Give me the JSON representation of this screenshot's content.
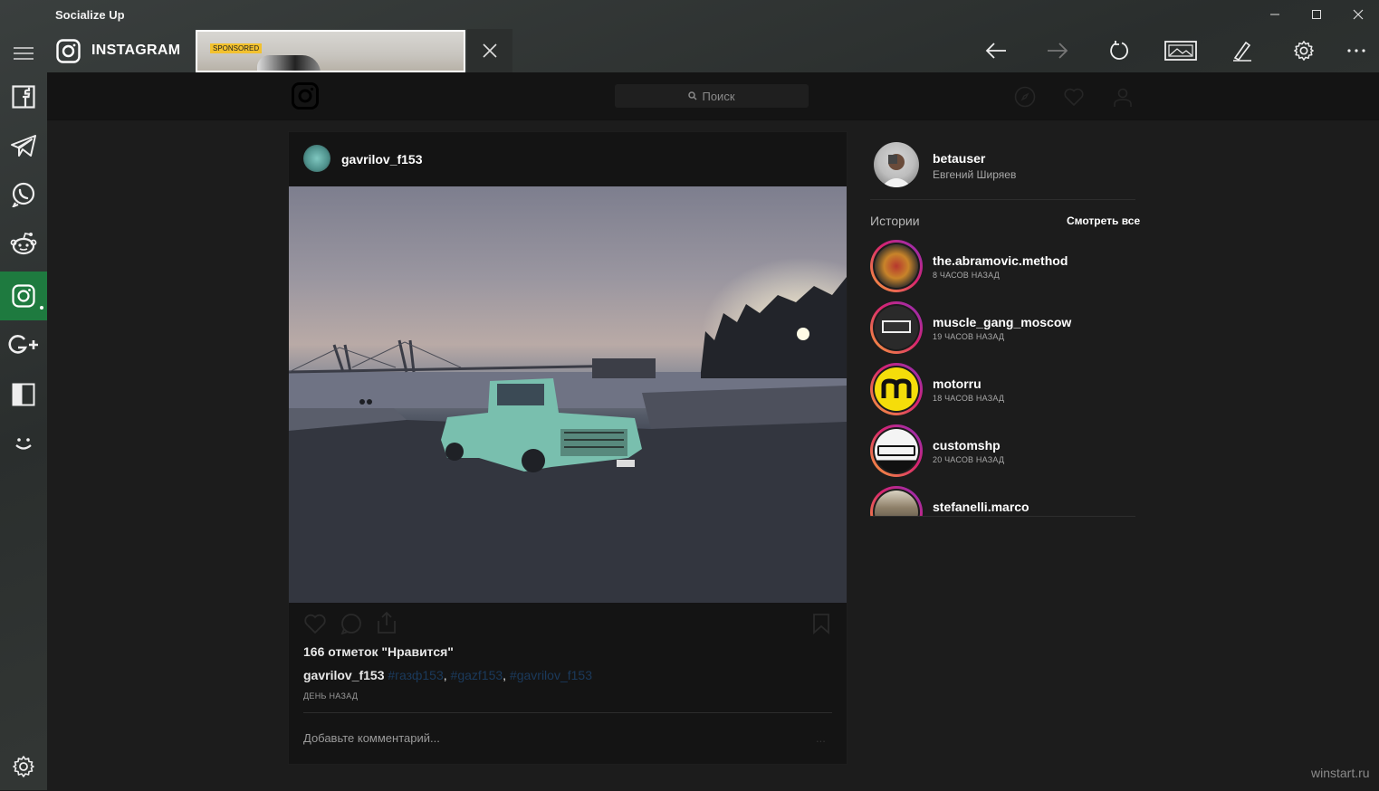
{
  "app": {
    "title": "Socialize Up"
  },
  "window": {
    "minimize": "minimize-icon",
    "maximize": "maximize-icon",
    "close": "close-icon"
  },
  "tab": {
    "name": "INSTAGRAM"
  },
  "ad": {
    "badge": "SPONSORED"
  },
  "header": {
    "search_placeholder": "Поиск"
  },
  "post": {
    "username": "gavrilov_f153",
    "likes": "166 отметок \"Нравится\"",
    "caption_user": "gavrilov_f153",
    "tags": [
      "#газф153",
      "#gazf153",
      "#gavrilov_f153"
    ],
    "time": "ДЕНЬ НАЗАД",
    "comment_placeholder": "Добавьте комментарий...",
    "more": "..."
  },
  "sidebar": {
    "user": {
      "username": "betauser",
      "full_name": "Евгений Ширяев"
    },
    "stories_title": "Истории",
    "see_all": "Смотреть все",
    "stories": [
      {
        "name": "the.abramovic.method",
        "time": "8 ЧАСОВ НАЗАД"
      },
      {
        "name": "muscle_gang_moscow",
        "time": "19 ЧАСОВ НАЗАД"
      },
      {
        "name": "motorru",
        "time": "18 ЧАСОВ НАЗАД"
      },
      {
        "name": "customshp",
        "time": "20 ЧАСОВ НАЗАД"
      },
      {
        "name": "stefanelli.marco",
        "time": ""
      }
    ]
  },
  "watermark": "winstart.ru",
  "colors": {
    "accent": "#1e7a3f",
    "story_ring_start": "#f9a23a",
    "story_ring_end": "#8a2fbf"
  }
}
